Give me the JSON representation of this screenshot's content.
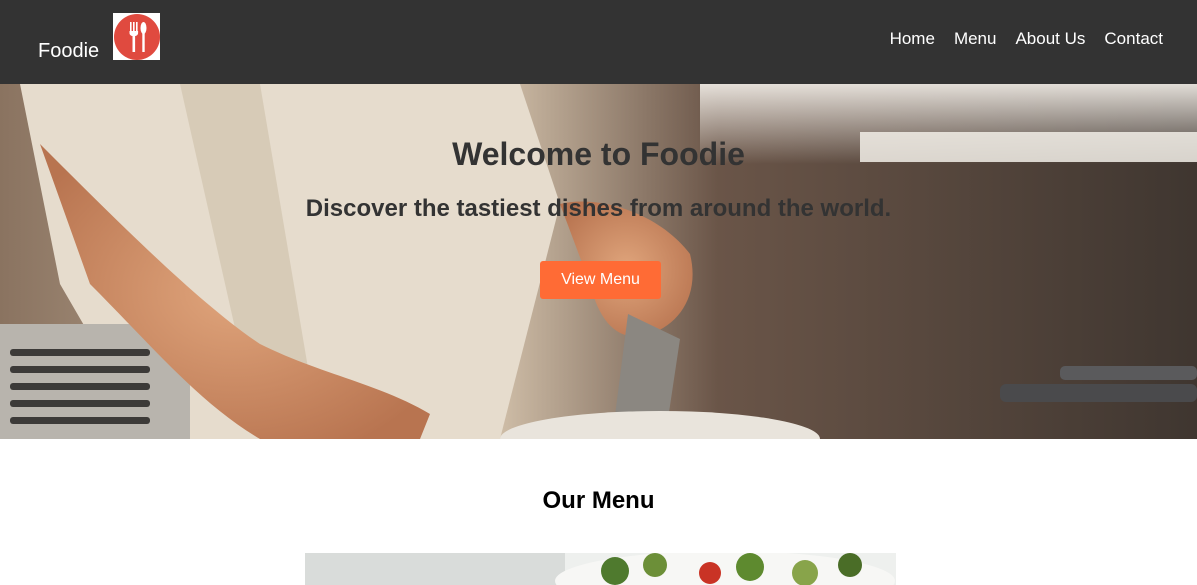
{
  "header": {
    "brand": "Foodie",
    "nav": [
      {
        "label": "Home"
      },
      {
        "label": "Menu"
      },
      {
        "label": "About Us"
      },
      {
        "label": "Contact"
      }
    ],
    "colors": {
      "background": "#333333",
      "logo": "#e04a3f"
    },
    "logo_icon": "fork-spoon-icon"
  },
  "hero": {
    "title": "Welcome to Foodie",
    "subtitle": "Discover the tastiest dishes from around the world.",
    "button_label": "View Menu",
    "colors": {
      "button": "#ff6b35"
    }
  },
  "menu": {
    "title": "Our Menu"
  }
}
